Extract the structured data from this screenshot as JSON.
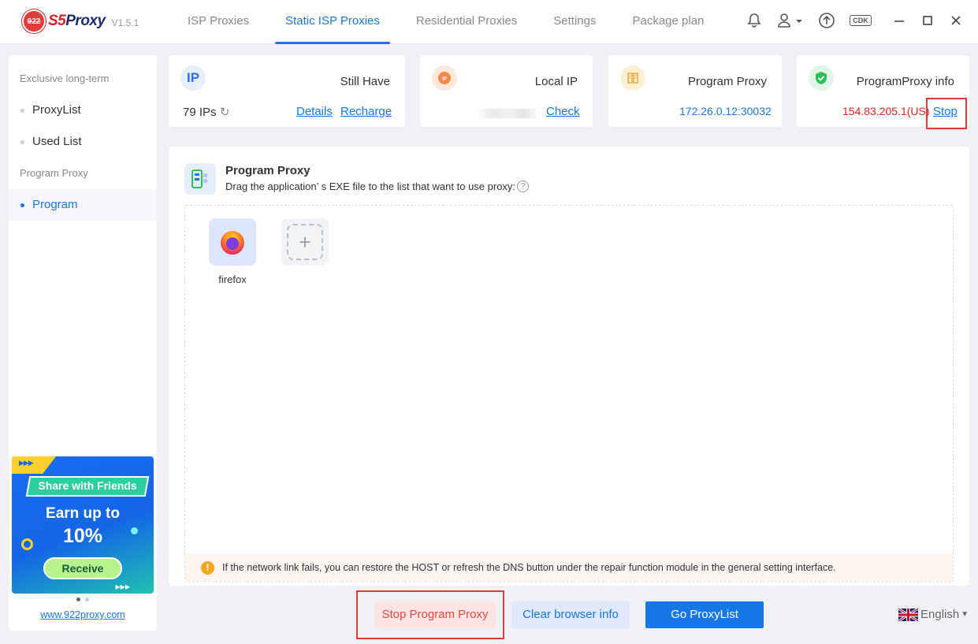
{
  "app": {
    "name_prefix": "S5",
    "name_suffix": "Proxy",
    "logo_badge": "922",
    "version": "V1.5.1"
  },
  "nav": {
    "tabs": [
      {
        "label": "ISP Proxies",
        "active": false
      },
      {
        "label": "Static ISP Proxies",
        "active": true
      },
      {
        "label": "Residential Proxies",
        "active": false
      },
      {
        "label": "Settings",
        "active": false
      },
      {
        "label": "Package plan",
        "active": false
      }
    ]
  },
  "header_icons": {
    "bell": "bell-icon",
    "user": "user-icon",
    "upload": "upload-icon",
    "cdk": "CDK",
    "minimize": "minimize-icon",
    "maximize": "maximize-icon",
    "close": "close-icon"
  },
  "sidebar": {
    "group1": "Exclusive long-term",
    "item_proxylist": "ProxyList",
    "item_usedlist": "Used List",
    "group2": "Program Proxy",
    "item_program": "Program",
    "banner": {
      "share": "Share with Friends",
      "earn": "Earn up to",
      "percent": "10%",
      "receive": "Receive"
    },
    "site": "www.922proxy.com"
  },
  "cards": {
    "still_have": {
      "icon_text": "IP",
      "title": "Still Have",
      "value": "79 IPs",
      "refresh": "↻",
      "details": "Details",
      "recharge": "Recharge"
    },
    "local_ip": {
      "icon_text": "IP",
      "title": "Local IP",
      "check": "Check"
    },
    "program_proxy": {
      "title": "Program Proxy",
      "value": "172.26.0.12:30032"
    },
    "proxy_info": {
      "title": "ProgramProxy info",
      "value": "154.83.205.1(US)",
      "stop": "Stop"
    }
  },
  "panel": {
    "title": "Program Proxy",
    "desc": "Drag the application’ s EXE file to the list that want to use proxy:",
    "help": "?",
    "apps": [
      {
        "label": "firefox"
      }
    ],
    "add": "+",
    "notice": "If the network link fails, you can restore the HOST or refresh the DNS button under the repair function module in the general setting interface.",
    "warn": "!"
  },
  "buttons": {
    "stop": "Stop Program Proxy",
    "clear": "Clear browser info",
    "go": "Go ProxyList"
  },
  "language": {
    "label": "English"
  },
  "colors": {
    "accent": "#1677e8",
    "danger": "#e8473f",
    "brand_red": "#d8232a"
  }
}
